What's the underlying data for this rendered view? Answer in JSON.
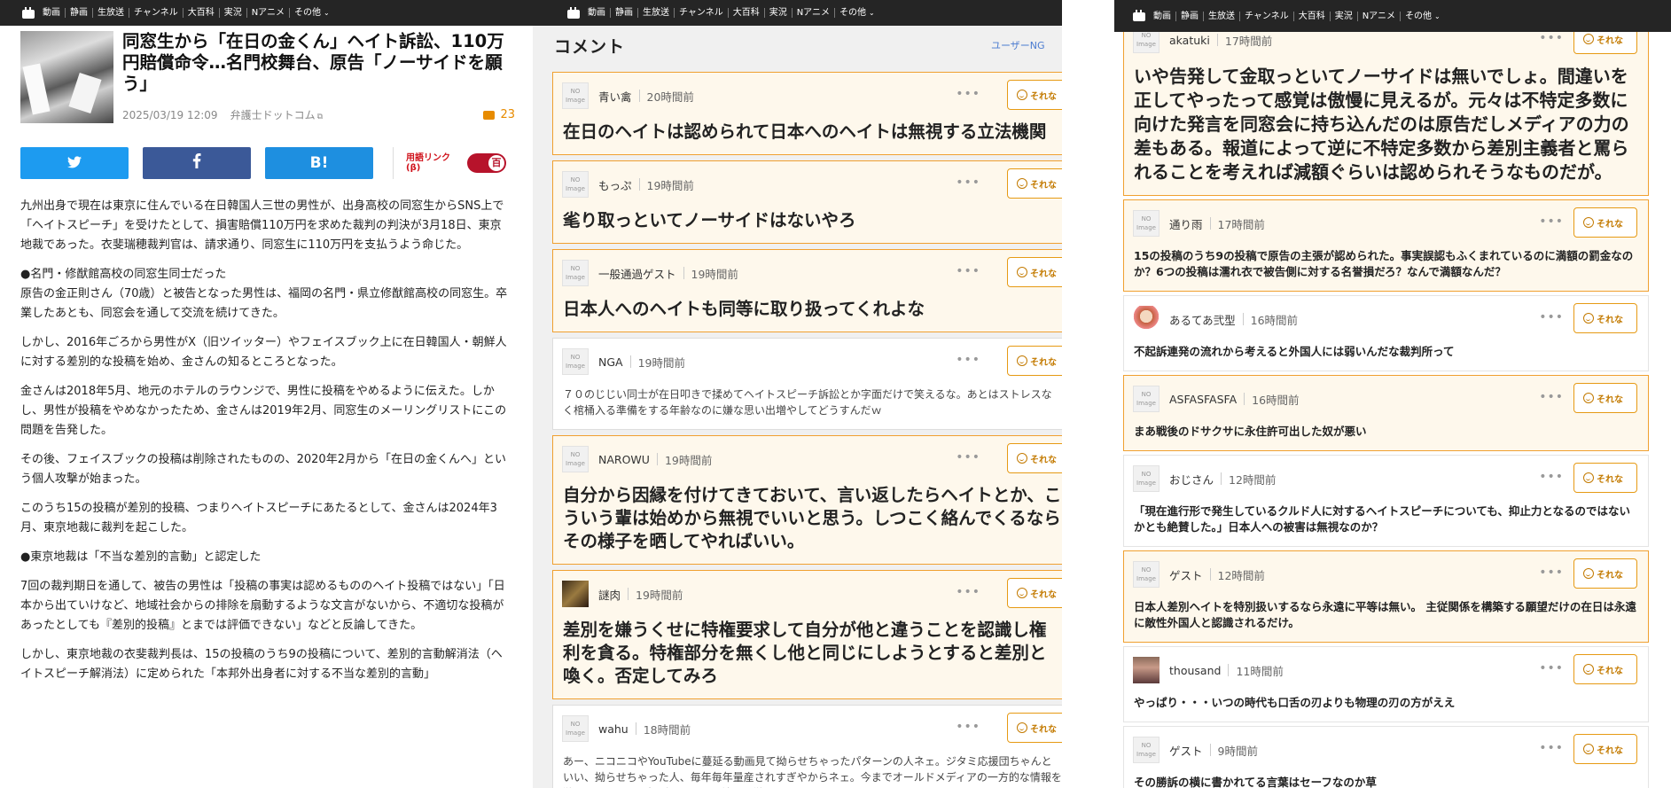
{
  "nav": {
    "items": [
      "動画",
      "静画",
      "生放送",
      "チャンネル",
      "大百科",
      "実況",
      "Nアニメ",
      "その他"
    ]
  },
  "article": {
    "title": "同窓生から「在日の金くん」ヘイト訴訟、110万円賠償命令…名門校舞台、原告「ノーサイドを願う」",
    "date": "2025/03/19 12:09",
    "source": "弁護士ドットコム",
    "comment_count": "23",
    "share_labels": {
      "hatena": "B!"
    },
    "term_link_label": "用語リンク(β)",
    "toggle_glyph": "百",
    "paragraphs": [
      "九州出身で現在は東京に住んでいる在日韓国人三世の男性が、出身高校の同窓生からSNS上で「ヘイトスピーチ」を受けたとして、損害賠償110万円を求めた裁判の判決が3月18日、東京地裁であった。衣斐瑞穂裁判官は、請求通り、同窓生に110万円を支払うよう命じた。",
      "●名門・修猷館高校の同窓生同士だった\n原告の金正則さん（70歳）と被告となった男性は、福岡の名門・県立修猷館高校の同窓生。卒業したあとも、同窓会を通して交流を続けてきた。",
      "しかし、2016年ごろから男性がX（旧ツイッター）やフェイスブック上に在日韓国人・朝鮮人に対する差別的な投稿を始め、金さんの知るところとなった。",
      "金さんは2018年5月、地元のホテルのラウンジで、男性に投稿をやめるように伝えた。しかし、男性が投稿をやめなかったため、金さんは2019年2月、同窓生のメーリングリストにこの問題を告発した。",
      "その後、フェイスブックの投稿は削除されたものの、2020年2月から「在日の金くんへ」という個人攻撃が始まった。",
      "このうち15の投稿が差別的投稿、つまりヘイトスピーチにあたるとして、金さんは2024年3月、東京地裁に裁判を起こした。",
      "●東京地裁は「不当な差別的言動」と認定した",
      "7回の裁判期日を通して、被告の男性は「投稿の事実は認めるもののヘイト投稿ではない」「日本から出ていけなど、地域社会からの排除を扇動するような文言がないから、不適切な投稿があったとしても『差別的投稿』とまでは評価できない」などと反論してきた。",
      "しかし、東京地裁の衣斐裁判長は、15の投稿のうち9の投稿について、差別的言動解消法（ヘイトスピーチ解消法）に定められた「本邦外出身者に対する不当な差別的言動」"
    ]
  },
  "comments_header": {
    "title": "コメント",
    "ng_label": "ユーザーNG"
  },
  "sorena_label": "それな",
  "no_image_label": "NO Image",
  "comments_mid": [
    {
      "user": "青い禽",
      "time": "20時間前",
      "text": "在日のヘイトは認められて日本へのヘイトは無視する立法機関",
      "size": "big",
      "hl": true,
      "avatar": "none"
    },
    {
      "user": "もっぷ",
      "time": "19時間前",
      "text": "毟り取っといてノーサイドはないやろ",
      "size": "big",
      "hl": true,
      "avatar": "none"
    },
    {
      "user": "一般通過ゲスト",
      "time": "19時間前",
      "text": "日本人へのヘイトも同等に取り扱ってくれよな",
      "size": "big",
      "hl": true,
      "avatar": "none"
    },
    {
      "user": "NGA",
      "time": "19時間前",
      "text": "７０のじじい同士が在日叩きで揉めてヘイトスピーチ訴訟とか字面だけで笑えるな。あとはストレスなく棺桶入る準備をする年齢なのに嫌な思い出増やしてどうすんだｗ",
      "size": "small",
      "hl": false,
      "avatar": "none"
    },
    {
      "user": "NAROWU",
      "time": "19時間前",
      "text": "自分から因縁を付けてきておいて、言い返したらヘイトとか、こういう輩は始めから無視でいいと思う。しつこく絡んでくるならその様子を晒してやればいい。",
      "size": "big",
      "hl": true,
      "avatar": "none"
    },
    {
      "user": "謎肉",
      "time": "19時間前",
      "text": "差別を嫌うくせに特権要求して自分が他と違うことを認識し権利を貪る。特権部分を無くし他と同じにしようとすると差別と喚く。否定してみろ",
      "size": "big",
      "hl": true,
      "avatar": "img1"
    },
    {
      "user": "wahu",
      "time": "18時間前",
      "text": "あー、ニコニコやYouTubeに蔓延る動画見て拗らせちゃったパターンの人ネェ。ジタミ応援団ちゃんといい、拗らせちゃった人、毎年毎年量産されすぎやからネェ。今までオールドメディアの一方的な情報を鵜呑みにしてきた奴が、ネットの情報を鵜呑みにしてるだけ",
      "size": "small",
      "hl": false,
      "avatar": "none"
    }
  ],
  "comments_right": [
    {
      "user": "akatuki",
      "time": "17時間前",
      "text": "いや告発して金取っといてノーサイドは無いでしょ。間違いを正してやったって感覚は傲慢に見えるが。元々は不特定多数に向けた発言を同窓会に持ち込んだのは原告だしメディアの力の差もある。報道によって逆に不特定多数から差別主義者と罵られることを考えれば減額ぐらいは認められそうなものだが。",
      "size": "big",
      "hl": true,
      "avatar": "none"
    },
    {
      "user": "通り雨",
      "time": "17時間前",
      "text": "15の投稿のうち9の投稿で原告の主張が認められた。事実誤認もふくまれているのに満額の罰金なのか？6つの投稿は濡れ衣で被告側に対する名誉損だろ？なんで満額なんだ？",
      "size": "mid",
      "hl": true,
      "avatar": "none"
    },
    {
      "user": "あるてあ弐型",
      "time": "16時間前",
      "text": "不起訴連発の流れから考えると外国人には弱いんだな裁判所って",
      "size": "mid",
      "hl": false,
      "avatar": "img2"
    },
    {
      "user": "ASFASFASFA",
      "time": "16時間前",
      "text": "まあ戦後のドサクサに永住許可出した奴が悪い",
      "size": "mid",
      "hl": true,
      "avatar": "none"
    },
    {
      "user": "おじさん",
      "time": "12時間前",
      "text": "「現在進行形で発生しているクルド人に対するヘイトスピーチについても、抑止力となるのではないかとも絶賛した。」日本人への被害は無視なのか？",
      "size": "mid",
      "hl": false,
      "avatar": "none"
    },
    {
      "user": "ゲスト",
      "time": "12時間前",
      "text": "日本人差別ヘイトを特別扱いするなら永遠に平等は無い。 主従関係を構築する願望だけの在日は永遠に敵性外国人と認識されるだけ。",
      "size": "mid",
      "hl": true,
      "avatar": "none"
    },
    {
      "user": "thousand",
      "time": "11時間前",
      "text": "やっぱり・・・いつの時代も口舌の刃よりも物理の刃の方がええ",
      "size": "mid",
      "hl": false,
      "avatar": "img3"
    },
    {
      "user": "ゲスト",
      "time": "9時間前",
      "text": "その勝訴の横に書かれてる言葉はセーフなのか草",
      "size": "mid",
      "hl": false,
      "avatar": "none"
    }
  ]
}
